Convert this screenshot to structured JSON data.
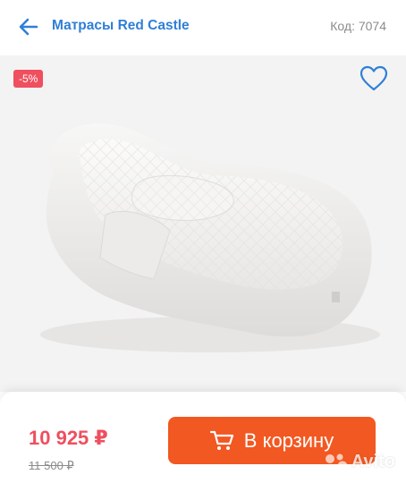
{
  "header": {
    "title": "Матрасы Red Castle",
    "code": "Код: 7074",
    "back_icon": "arrow-left-icon"
  },
  "product": {
    "discount_badge": "-5%",
    "favorite_icon": "heart-outline-icon",
    "image": "white quilted baby nest cocoon mattress"
  },
  "purchase": {
    "price": "10 925 ₽",
    "old_price": "11 500 ₽",
    "cart_button_label": "В корзину",
    "cart_icon": "cart-icon"
  },
  "watermark": {
    "text": "Avito"
  },
  "colors": {
    "accent_blue": "#2f7fd7",
    "discount_red": "#ef4f5e",
    "cart_orange": "#f25822"
  }
}
